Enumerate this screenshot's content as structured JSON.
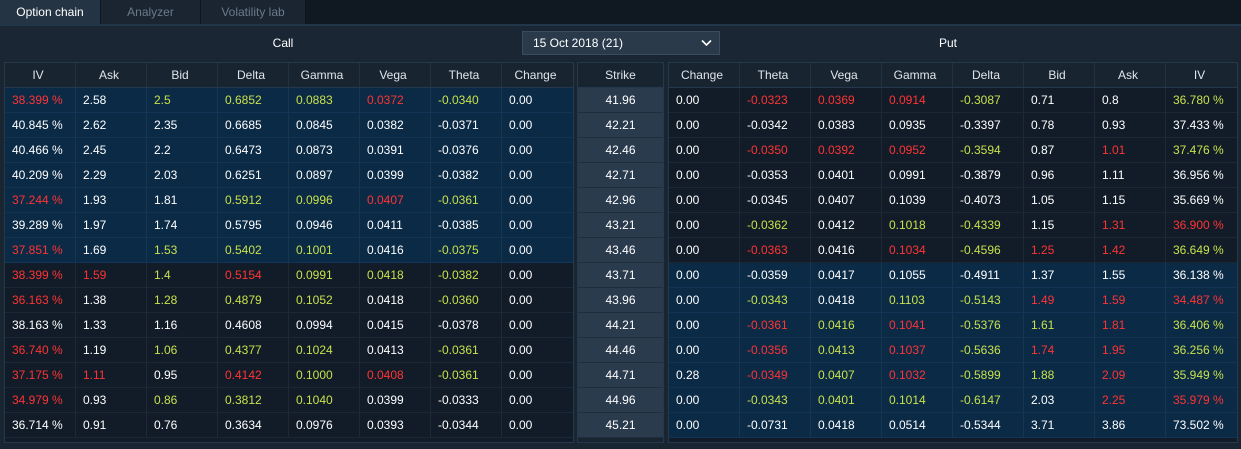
{
  "tabs": [
    {
      "label": "Option chain",
      "active": true
    },
    {
      "label": "Analyzer",
      "active": false
    },
    {
      "label": "Volatility lab",
      "active": false
    }
  ],
  "call_label": "Call",
  "put_label": "Put",
  "expiry": {
    "selected": "15 Oct 2018 (21)"
  },
  "strike_header": "Strike",
  "call_columns": [
    "IV",
    "Ask",
    "Bid",
    "Delta",
    "Gamma",
    "Vega",
    "Theta",
    "Change"
  ],
  "put_columns": [
    "Change",
    "Theta",
    "Vega",
    "Gamma",
    "Delta",
    "Bid",
    "Ask",
    "IV"
  ],
  "colors": {
    "itm_row": "#0b2a46",
    "otm_row": "#111c28",
    "strike_cell": "#2b3b4e",
    "positive": "#c8e14c",
    "negative": "#ff3434",
    "neutral": "#ffffff"
  },
  "rows": [
    {
      "strike": "41.96",
      "call_itm": true,
      "put_itm": false,
      "call": [
        [
          "38.399 %",
          "#ff3434"
        ],
        [
          "2.58",
          "#ffffff"
        ],
        [
          "2.5",
          "#c8e14c"
        ],
        [
          "0.6852",
          "#c8e14c"
        ],
        [
          "0.0883",
          "#c8e14c"
        ],
        [
          "0.0372",
          "#ff3434"
        ],
        [
          "-0.0340",
          "#c8e14c"
        ],
        [
          "0.00",
          "#ffffff"
        ]
      ],
      "put": [
        [
          "0.00",
          "#ffffff"
        ],
        [
          "-0.0323",
          "#ff3434"
        ],
        [
          "0.0369",
          "#ff3434"
        ],
        [
          "0.0914",
          "#ff3434"
        ],
        [
          "-0.3087",
          "#c8e14c"
        ],
        [
          "0.71",
          "#ffffff"
        ],
        [
          "0.8",
          "#ffffff"
        ],
        [
          "36.780 %",
          "#c8e14c"
        ]
      ]
    },
    {
      "strike": "42.21",
      "call_itm": true,
      "put_itm": false,
      "call": [
        [
          "40.845 %",
          "#ffffff"
        ],
        [
          "2.62",
          "#ffffff"
        ],
        [
          "2.35",
          "#ffffff"
        ],
        [
          "0.6685",
          "#ffffff"
        ],
        [
          "0.0845",
          "#ffffff"
        ],
        [
          "0.0382",
          "#ffffff"
        ],
        [
          "-0.0371",
          "#ffffff"
        ],
        [
          "0.00",
          "#ffffff"
        ]
      ],
      "put": [
        [
          "0.00",
          "#ffffff"
        ],
        [
          "-0.0342",
          "#ffffff"
        ],
        [
          "0.0383",
          "#ffffff"
        ],
        [
          "0.0935",
          "#ffffff"
        ],
        [
          "-0.3397",
          "#ffffff"
        ],
        [
          "0.78",
          "#ffffff"
        ],
        [
          "0.93",
          "#ffffff"
        ],
        [
          "37.433 %",
          "#ffffff"
        ]
      ]
    },
    {
      "strike": "42.46",
      "call_itm": true,
      "put_itm": false,
      "call": [
        [
          "40.466 %",
          "#ffffff"
        ],
        [
          "2.45",
          "#ffffff"
        ],
        [
          "2.2",
          "#ffffff"
        ],
        [
          "0.6473",
          "#ffffff"
        ],
        [
          "0.0873",
          "#ffffff"
        ],
        [
          "0.0391",
          "#ffffff"
        ],
        [
          "-0.0376",
          "#ffffff"
        ],
        [
          "0.00",
          "#ffffff"
        ]
      ],
      "put": [
        [
          "0.00",
          "#ffffff"
        ],
        [
          "-0.0350",
          "#ff3434"
        ],
        [
          "0.0392",
          "#ff3434"
        ],
        [
          "0.0952",
          "#ff3434"
        ],
        [
          "-0.3594",
          "#c8e14c"
        ],
        [
          "0.87",
          "#ffffff"
        ],
        [
          "1.01",
          "#ff3434"
        ],
        [
          "37.476 %",
          "#c8e14c"
        ]
      ]
    },
    {
      "strike": "42.71",
      "call_itm": true,
      "put_itm": false,
      "call": [
        [
          "40.209 %",
          "#ffffff"
        ],
        [
          "2.29",
          "#ffffff"
        ],
        [
          "2.03",
          "#ffffff"
        ],
        [
          "0.6251",
          "#ffffff"
        ],
        [
          "0.0897",
          "#ffffff"
        ],
        [
          "0.0399",
          "#ffffff"
        ],
        [
          "-0.0382",
          "#ffffff"
        ],
        [
          "0.00",
          "#ffffff"
        ]
      ],
      "put": [
        [
          "0.00",
          "#ffffff"
        ],
        [
          "-0.0353",
          "#ffffff"
        ],
        [
          "0.0401",
          "#ffffff"
        ],
        [
          "0.0991",
          "#ffffff"
        ],
        [
          "-0.3879",
          "#ffffff"
        ],
        [
          "0.96",
          "#ffffff"
        ],
        [
          "1.11",
          "#ffffff"
        ],
        [
          "36.956 %",
          "#ffffff"
        ]
      ]
    },
    {
      "strike": "42.96",
      "call_itm": true,
      "put_itm": false,
      "call": [
        [
          "37.244 %",
          "#ff3434"
        ],
        [
          "1.93",
          "#ffffff"
        ],
        [
          "1.81",
          "#ffffff"
        ],
        [
          "0.5912",
          "#c8e14c"
        ],
        [
          "0.0996",
          "#c8e14c"
        ],
        [
          "0.0407",
          "#ff3434"
        ],
        [
          "-0.0361",
          "#c8e14c"
        ],
        [
          "0.00",
          "#ffffff"
        ]
      ],
      "put": [
        [
          "0.00",
          "#ffffff"
        ],
        [
          "-0.0345",
          "#ffffff"
        ],
        [
          "0.0407",
          "#ffffff"
        ],
        [
          "0.1039",
          "#ffffff"
        ],
        [
          "-0.4073",
          "#ffffff"
        ],
        [
          "1.05",
          "#ffffff"
        ],
        [
          "1.15",
          "#ffffff"
        ],
        [
          "35.669 %",
          "#ffffff"
        ]
      ]
    },
    {
      "strike": "43.21",
      "call_itm": true,
      "put_itm": false,
      "call": [
        [
          "39.289 %",
          "#ffffff"
        ],
        [
          "1.97",
          "#ffffff"
        ],
        [
          "1.74",
          "#ffffff"
        ],
        [
          "0.5795",
          "#ffffff"
        ],
        [
          "0.0946",
          "#ffffff"
        ],
        [
          "0.0411",
          "#ffffff"
        ],
        [
          "-0.0385",
          "#ffffff"
        ],
        [
          "0.00",
          "#ffffff"
        ]
      ],
      "put": [
        [
          "0.00",
          "#ffffff"
        ],
        [
          "-0.0362",
          "#c8e14c"
        ],
        [
          "0.0412",
          "#ffffff"
        ],
        [
          "0.1018",
          "#c8e14c"
        ],
        [
          "-0.4339",
          "#c8e14c"
        ],
        [
          "1.15",
          "#ffffff"
        ],
        [
          "1.31",
          "#ff3434"
        ],
        [
          "36.900 %",
          "#ff3434"
        ]
      ]
    },
    {
      "strike": "43.46",
      "call_itm": true,
      "put_itm": false,
      "call": [
        [
          "37.851 %",
          "#ff3434"
        ],
        [
          "1.69",
          "#ffffff"
        ],
        [
          "1.53",
          "#c8e14c"
        ],
        [
          "0.5402",
          "#c8e14c"
        ],
        [
          "0.1001",
          "#c8e14c"
        ],
        [
          "0.0416",
          "#ffffff"
        ],
        [
          "-0.0375",
          "#c8e14c"
        ],
        [
          "0.00",
          "#ffffff"
        ]
      ],
      "put": [
        [
          "0.00",
          "#ffffff"
        ],
        [
          "-0.0363",
          "#ff3434"
        ],
        [
          "0.0416",
          "#ffffff"
        ],
        [
          "0.1034",
          "#ff3434"
        ],
        [
          "-0.4596",
          "#c8e14c"
        ],
        [
          "1.25",
          "#ff3434"
        ],
        [
          "1.42",
          "#ff3434"
        ],
        [
          "36.649 %",
          "#c8e14c"
        ]
      ]
    },
    {
      "strike": "43.71",
      "call_itm": false,
      "put_itm": true,
      "call": [
        [
          "38.399 %",
          "#ff3434"
        ],
        [
          "1.59",
          "#ff3434"
        ],
        [
          "1.4",
          "#c8e14c"
        ],
        [
          "0.5154",
          "#ff3434"
        ],
        [
          "0.0991",
          "#c8e14c"
        ],
        [
          "0.0418",
          "#c8e14c"
        ],
        [
          "-0.0382",
          "#c8e14c"
        ],
        [
          "0.00",
          "#ffffff"
        ]
      ],
      "put": [
        [
          "0.00",
          "#ffffff"
        ],
        [
          "-0.0359",
          "#ffffff"
        ],
        [
          "0.0417",
          "#ffffff"
        ],
        [
          "0.1055",
          "#ffffff"
        ],
        [
          "-0.4911",
          "#ffffff"
        ],
        [
          "1.37",
          "#ffffff"
        ],
        [
          "1.55",
          "#ffffff"
        ],
        [
          "36.138 %",
          "#ffffff"
        ]
      ]
    },
    {
      "strike": "43.96",
      "call_itm": false,
      "put_itm": true,
      "call": [
        [
          "36.163 %",
          "#ff3434"
        ],
        [
          "1.38",
          "#ffffff"
        ],
        [
          "1.28",
          "#c8e14c"
        ],
        [
          "0.4879",
          "#c8e14c"
        ],
        [
          "0.1052",
          "#c8e14c"
        ],
        [
          "0.0418",
          "#ffffff"
        ],
        [
          "-0.0360",
          "#c8e14c"
        ],
        [
          "0.00",
          "#ffffff"
        ]
      ],
      "put": [
        [
          "0.00",
          "#ffffff"
        ],
        [
          "-0.0343",
          "#c8e14c"
        ],
        [
          "0.0418",
          "#ffffff"
        ],
        [
          "0.1103",
          "#c8e14c"
        ],
        [
          "-0.5143",
          "#c8e14c"
        ],
        [
          "1.49",
          "#ff3434"
        ],
        [
          "1.59",
          "#ff3434"
        ],
        [
          "34.487 %",
          "#ff3434"
        ]
      ]
    },
    {
      "strike": "44.21",
      "call_itm": false,
      "put_itm": true,
      "call": [
        [
          "38.163 %",
          "#ffffff"
        ],
        [
          "1.33",
          "#ffffff"
        ],
        [
          "1.16",
          "#ffffff"
        ],
        [
          "0.4608",
          "#ffffff"
        ],
        [
          "0.0994",
          "#ffffff"
        ],
        [
          "0.0415",
          "#ffffff"
        ],
        [
          "-0.0378",
          "#ffffff"
        ],
        [
          "0.00",
          "#ffffff"
        ]
      ],
      "put": [
        [
          "0.00",
          "#ffffff"
        ],
        [
          "-0.0361",
          "#ff3434"
        ],
        [
          "0.0416",
          "#c8e14c"
        ],
        [
          "0.1041",
          "#ff3434"
        ],
        [
          "-0.5376",
          "#c8e14c"
        ],
        [
          "1.61",
          "#c8e14c"
        ],
        [
          "1.81",
          "#ff3434"
        ],
        [
          "36.406 %",
          "#c8e14c"
        ]
      ]
    },
    {
      "strike": "44.46",
      "call_itm": false,
      "put_itm": true,
      "call": [
        [
          "36.740 %",
          "#ff3434"
        ],
        [
          "1.19",
          "#ffffff"
        ],
        [
          "1.06",
          "#c8e14c"
        ],
        [
          "0.4377",
          "#c8e14c"
        ],
        [
          "0.1024",
          "#c8e14c"
        ],
        [
          "0.0413",
          "#ffffff"
        ],
        [
          "-0.0361",
          "#c8e14c"
        ],
        [
          "0.00",
          "#ffffff"
        ]
      ],
      "put": [
        [
          "0.00",
          "#ffffff"
        ],
        [
          "-0.0356",
          "#ff3434"
        ],
        [
          "0.0413",
          "#c8e14c"
        ],
        [
          "0.1037",
          "#ff3434"
        ],
        [
          "-0.5636",
          "#c8e14c"
        ],
        [
          "1.74",
          "#ff3434"
        ],
        [
          "1.95",
          "#ff3434"
        ],
        [
          "36.256 %",
          "#c8e14c"
        ]
      ]
    },
    {
      "strike": "44.71",
      "call_itm": false,
      "put_itm": true,
      "call": [
        [
          "37.175 %",
          "#ff3434"
        ],
        [
          "1.11",
          "#ff3434"
        ],
        [
          "0.95",
          "#ffffff"
        ],
        [
          "0.4142",
          "#ff3434"
        ],
        [
          "0.1000",
          "#c8e14c"
        ],
        [
          "0.0408",
          "#ff3434"
        ],
        [
          "-0.0361",
          "#c8e14c"
        ],
        [
          "0.00",
          "#ffffff"
        ]
      ],
      "put": [
        [
          "0.28",
          "#ffffff"
        ],
        [
          "-0.0349",
          "#ff3434"
        ],
        [
          "0.0407",
          "#c8e14c"
        ],
        [
          "0.1032",
          "#ff3434"
        ],
        [
          "-0.5899",
          "#c8e14c"
        ],
        [
          "1.88",
          "#c8e14c"
        ],
        [
          "2.09",
          "#ff3434"
        ],
        [
          "35.949 %",
          "#c8e14c"
        ]
      ]
    },
    {
      "strike": "44.96",
      "call_itm": false,
      "put_itm": true,
      "call": [
        [
          "34.979 %",
          "#ff3434"
        ],
        [
          "0.93",
          "#ffffff"
        ],
        [
          "0.86",
          "#c8e14c"
        ],
        [
          "0.3812",
          "#c8e14c"
        ],
        [
          "0.1040",
          "#c8e14c"
        ],
        [
          "0.0399",
          "#ffffff"
        ],
        [
          "-0.0333",
          "#ffffff"
        ],
        [
          "0.00",
          "#ffffff"
        ]
      ],
      "put": [
        [
          "0.00",
          "#ffffff"
        ],
        [
          "-0.0343",
          "#c8e14c"
        ],
        [
          "0.0401",
          "#c8e14c"
        ],
        [
          "0.1014",
          "#c8e14c"
        ],
        [
          "-0.6147",
          "#c8e14c"
        ],
        [
          "2.03",
          "#ffffff"
        ],
        [
          "2.25",
          "#ff3434"
        ],
        [
          "35.979 %",
          "#ff3434"
        ]
      ]
    },
    {
      "strike": "45.21",
      "call_itm": false,
      "put_itm": true,
      "call": [
        [
          "36.714 %",
          "#ffffff"
        ],
        [
          "0.91",
          "#ffffff"
        ],
        [
          "0.76",
          "#ffffff"
        ],
        [
          "0.3634",
          "#ffffff"
        ],
        [
          "0.0976",
          "#ffffff"
        ],
        [
          "0.0393",
          "#ffffff"
        ],
        [
          "-0.0344",
          "#ffffff"
        ],
        [
          "0.00",
          "#ffffff"
        ]
      ],
      "put": [
        [
          "0.00",
          "#ffffff"
        ],
        [
          "-0.0731",
          "#ffffff"
        ],
        [
          "0.0418",
          "#ffffff"
        ],
        [
          "0.0514",
          "#ffffff"
        ],
        [
          "-0.5344",
          "#ffffff"
        ],
        [
          "3.71",
          "#ffffff"
        ],
        [
          "3.86",
          "#ffffff"
        ],
        [
          "73.502 %",
          "#ffffff"
        ]
      ]
    }
  ]
}
